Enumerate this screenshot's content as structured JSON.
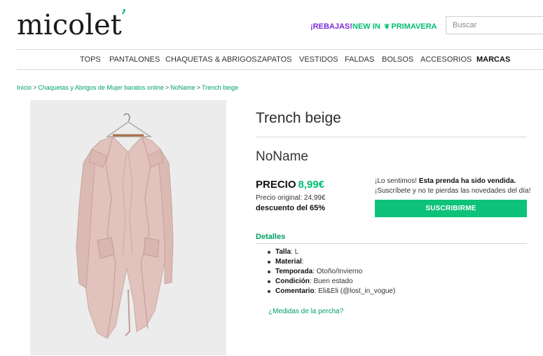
{
  "header": {
    "logo_text": "micolet",
    "logo_mark": "’",
    "promos": {
      "rebajas": "¡REBAJAS!",
      "new_in": "NEW IN",
      "primavera": "PRIMAVERA"
    },
    "search_placeholder": "Buscar"
  },
  "nav": [
    "TOPS",
    "PANTALONES",
    "CHAQUETAS & ABRIGOS",
    "ZAPATOS",
    "VESTIDOS",
    "FALDAS",
    "BOLSOS",
    "ACCESORIOS",
    "MARCAS"
  ],
  "breadcrumb": [
    "Inicio",
    "Chaquetas y Abrigos de Mujer baratos online",
    "NoName",
    "Trench beige"
  ],
  "product": {
    "title": "Trench beige",
    "brand": "NoName",
    "price_label": "PRECIO",
    "price": "8,99€",
    "original_price": "Precio original: 24,99€",
    "discount": "descuento del 65%"
  },
  "sold": {
    "line1_prefix": "¡Lo sentimos! ",
    "line1_bold": "Esta prenda ha sido vendida.",
    "line2": "¡Suscríbete y no te pierdas las novedades del día!",
    "button": "SUSCRIBIRME"
  },
  "details": {
    "title": "Detalles",
    "items": [
      {
        "label": "Talla",
        "value": " L"
      },
      {
        "label": "Material",
        "value": ""
      },
      {
        "label": "Temporada",
        "value": " Otoño/Invierno"
      },
      {
        "label": "Condición",
        "value": " Buen estado"
      },
      {
        "label": "Comentario",
        "value": " Eli&Eli (@lost_in_vogue)"
      }
    ],
    "hanger_link": "¿Medidas de la percha?"
  },
  "colors": {
    "accent_green": "#00bf6f",
    "rebajas_purple": "#7b2ad8",
    "garment": "#e2c2bc"
  }
}
